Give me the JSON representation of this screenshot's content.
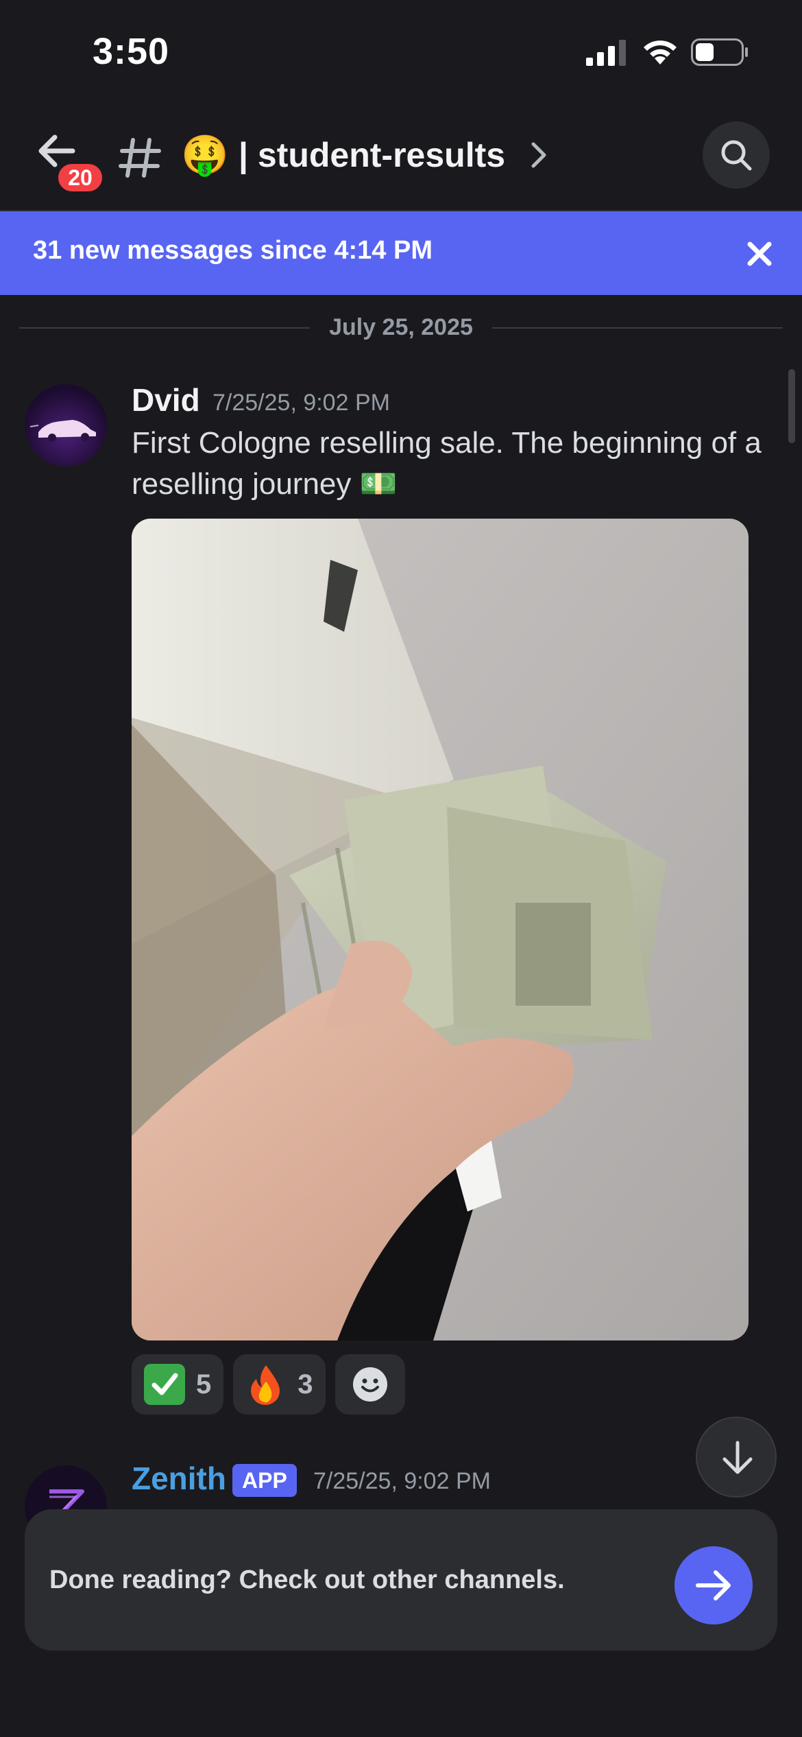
{
  "status_bar": {
    "time": "3:50",
    "signal_icon": "cellular-signal-icon",
    "wifi_icon": "wifi-icon",
    "battery_icon": "battery-icon",
    "battery_level": 0.35
  },
  "header": {
    "back_icon": "arrow-left-icon",
    "unread_count": "20",
    "channel_type_icon": "hash-icon",
    "channel_emoji": "🤑",
    "channel_name": "| student-results",
    "chevron_icon": "chevron-right-icon",
    "search_icon": "search-icon"
  },
  "new_messages_bar": {
    "text": "31 new messages since 4:14 PM",
    "close_icon": "close-icon",
    "color": "#5865f2"
  },
  "date_divider": "July 25, 2025",
  "messages": [
    {
      "author": "Dvid",
      "timestamp": "7/25/25, 9:02 PM",
      "text": "First Cologne reselling sale. The beginning of a reselling journey 💵",
      "attachment_alt": "Hand holding cash",
      "reactions": [
        {
          "emoji": "✅",
          "count": "5"
        },
        {
          "emoji": "🔥",
          "count": "3"
        }
      ],
      "add_reaction_icon": "smiley-add-reaction-icon"
    },
    {
      "author": "Zenith",
      "tag": "APP",
      "timestamp": "7/25/25, 9:02 PM",
      "author_color": "#4a9fe0"
    }
  ],
  "jump_to_bottom_icon": "arrow-down-icon",
  "done_banner": {
    "text": "Done reading? Check out other channels.",
    "arrow_icon": "arrow-right-icon"
  },
  "colors": {
    "background": "#1a1a1e",
    "surface": "#2b2d31",
    "accent": "#5865f2",
    "badge": "#f23f43"
  }
}
